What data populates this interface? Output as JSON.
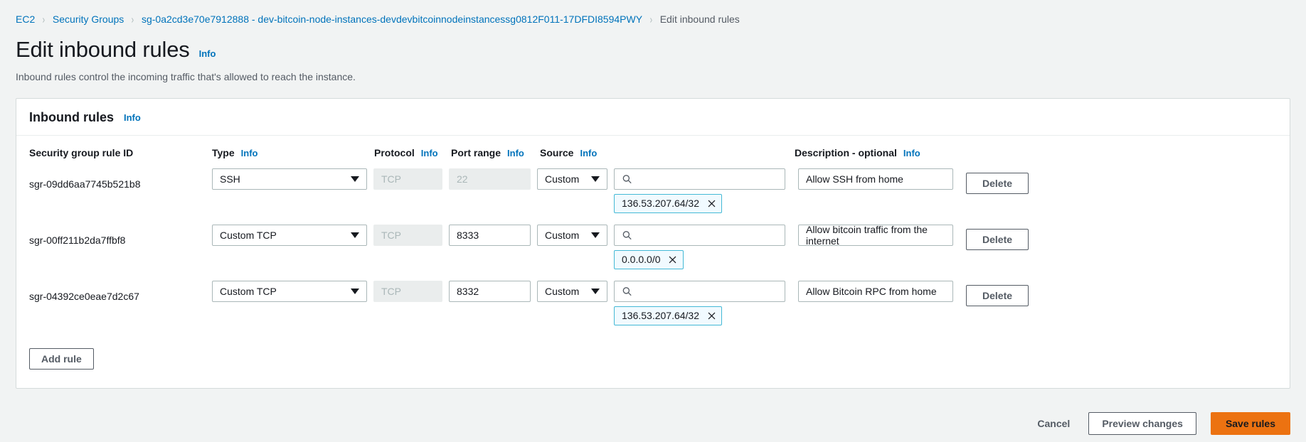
{
  "breadcrumb": {
    "items": [
      {
        "label": "EC2",
        "current": false
      },
      {
        "label": "Security Groups",
        "current": false
      },
      {
        "label": "sg-0a2cd3e70e7912888 - dev-bitcoin-node-instances-devdevbitcoinnodeinstancessg0812F011-17DFDI8594PWY",
        "current": false
      },
      {
        "label": "Edit inbound rules",
        "current": true
      }
    ],
    "separator": "›"
  },
  "page": {
    "title": "Edit inbound rules",
    "info_label": "Info",
    "subtitle": "Inbound rules control the incoming traffic that's allowed to reach the instance."
  },
  "panel": {
    "title": "Inbound rules",
    "info_label": "Info",
    "columns": {
      "rule_id": "Security group rule ID",
      "type": "Type",
      "protocol": "Protocol",
      "port_range": "Port range",
      "source": "Source",
      "description": "Description - optional"
    },
    "info_label_short": "Info",
    "search_icon": "search-icon",
    "remove_icon": "close-icon",
    "delete_label": "Delete",
    "add_rule_label": "Add rule"
  },
  "rules": [
    {
      "rule_id": "sgr-09dd6aa7745b521b8",
      "type": "SSH",
      "protocol": "TCP",
      "protocol_disabled": true,
      "port_range": "22",
      "port_disabled": true,
      "source": "Custom",
      "source_value": "",
      "cidr": "136.53.207.64/32",
      "description": "Allow SSH from home"
    },
    {
      "rule_id": "sgr-00ff211b2da7ffbf8",
      "type": "Custom TCP",
      "protocol": "TCP",
      "protocol_disabled": true,
      "port_range": "8333",
      "port_disabled": false,
      "source": "Custom",
      "source_value": "",
      "cidr": "0.0.0.0/0",
      "description": "Allow bitcoin traffic from the internet"
    },
    {
      "rule_id": "sgr-04392ce0eae7d2c67",
      "type": "Custom TCP",
      "protocol": "TCP",
      "protocol_disabled": true,
      "port_range": "8332",
      "port_disabled": false,
      "source": "Custom",
      "source_value": "",
      "cidr": "136.53.207.64/32",
      "description": "Allow Bitcoin RPC from home"
    }
  ],
  "footer": {
    "cancel_label": "Cancel",
    "preview_label": "Preview changes",
    "save_label": "Save rules"
  },
  "colors": {
    "link": "#0073bb",
    "text": "#16191f",
    "muted": "#545b64",
    "primary": "#ec7211",
    "tag_border": "#44b9d6",
    "tag_bg": "#f1faff",
    "page_bg": "#f1f3f3"
  }
}
